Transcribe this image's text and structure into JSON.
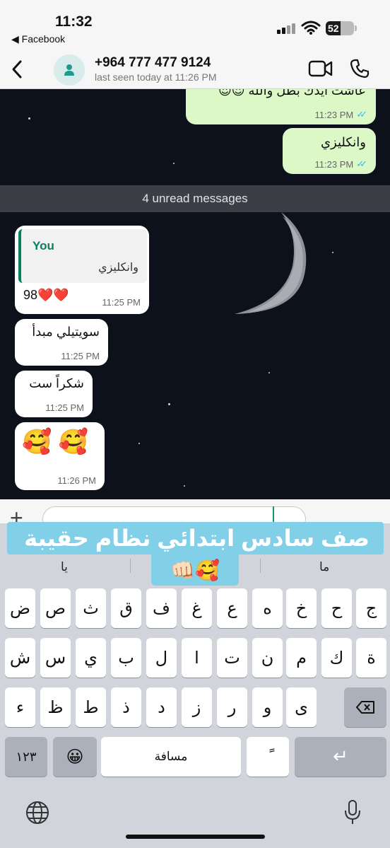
{
  "status_bar": {
    "time": "11:32",
    "back_app": "◀ Facebook",
    "battery": "52"
  },
  "header": {
    "contact_name": "+964 777 477 9124",
    "last_seen": "last seen today at 11:26 PM",
    "icons": {
      "back": "chevron-left-icon",
      "avatar": "person-icon",
      "video": "video-call-icon",
      "call": "phone-icon"
    }
  },
  "messages_out": [
    {
      "text": "عاشت ايدك بطل والله 😍😍",
      "time": "11:23 PM"
    },
    {
      "text": "وانكليزي",
      "time": "11:23 PM"
    }
  ],
  "unread_banner": "4 unread messages",
  "reply": {
    "quote_author": "You",
    "quote_text": "وانكليزي",
    "text": "98❤️❤️",
    "time": "11:25 PM"
  },
  "messages_in": [
    {
      "text": "سويتيلي مبدأ",
      "time": "11:25 PM"
    },
    {
      "text": "شكراً ست",
      "time": "11:25 PM"
    },
    {
      "text": "🥰 🥰",
      "time": "11:26 PM"
    }
  ],
  "caption": {
    "text": "صف سادس ابتدائي نظام حقيبة",
    "emoji": "👊🏻🥰"
  },
  "keyboard": {
    "suggestions": [
      "يا",
      "ما"
    ],
    "row1": [
      "ض",
      "ص",
      "ث",
      "ق",
      "ف",
      "غ",
      "ع",
      "ه",
      "خ",
      "ح",
      "ج"
    ],
    "row2": [
      "ش",
      "س",
      "ي",
      "ب",
      "ل",
      "ا",
      "ت",
      "ن",
      "م",
      "ك",
      "ة"
    ],
    "row3": [
      "ء",
      "ظ",
      "ط",
      "ذ",
      "د",
      "ز",
      "ر",
      "و",
      "ى"
    ],
    "numbers_key": "١٢٣",
    "space_key": "مسافة",
    "diacritic_key": "ً",
    "emoji_key": "😀",
    "return_key": "↵"
  },
  "colors": {
    "accent": "#06805f",
    "outgoing_bubble": "#dcf8c6",
    "read_ticks": "#34b7f1",
    "caption_bg": "#82cfe8"
  }
}
